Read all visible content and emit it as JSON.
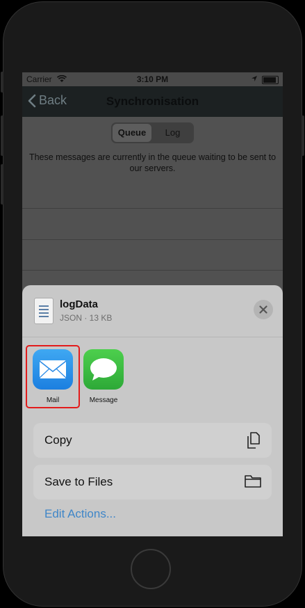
{
  "status_bar": {
    "carrier": "Carrier",
    "time": "3:10 PM"
  },
  "nav": {
    "back_label": "Back",
    "title": "Synchronisation"
  },
  "segments": {
    "active": "Queue",
    "inactive": "Log"
  },
  "queue_message": "These messages are currently in the queue waiting to be sent to our servers.",
  "sheet": {
    "file_name": "logData",
    "file_meta": "JSON · 13 KB",
    "apps": [
      {
        "label": "Mail",
        "icon": "mail-icon"
      },
      {
        "label": "Message",
        "icon": "message-icon"
      }
    ],
    "actions": [
      {
        "label": "Copy",
        "icon": "copy-icon"
      },
      {
        "label": "Save to Files",
        "icon": "folder-icon"
      }
    ],
    "edit_actions": "Edit Actions..."
  },
  "colors": {
    "highlight": "#e31b1b",
    "link": "#3f86c8"
  }
}
